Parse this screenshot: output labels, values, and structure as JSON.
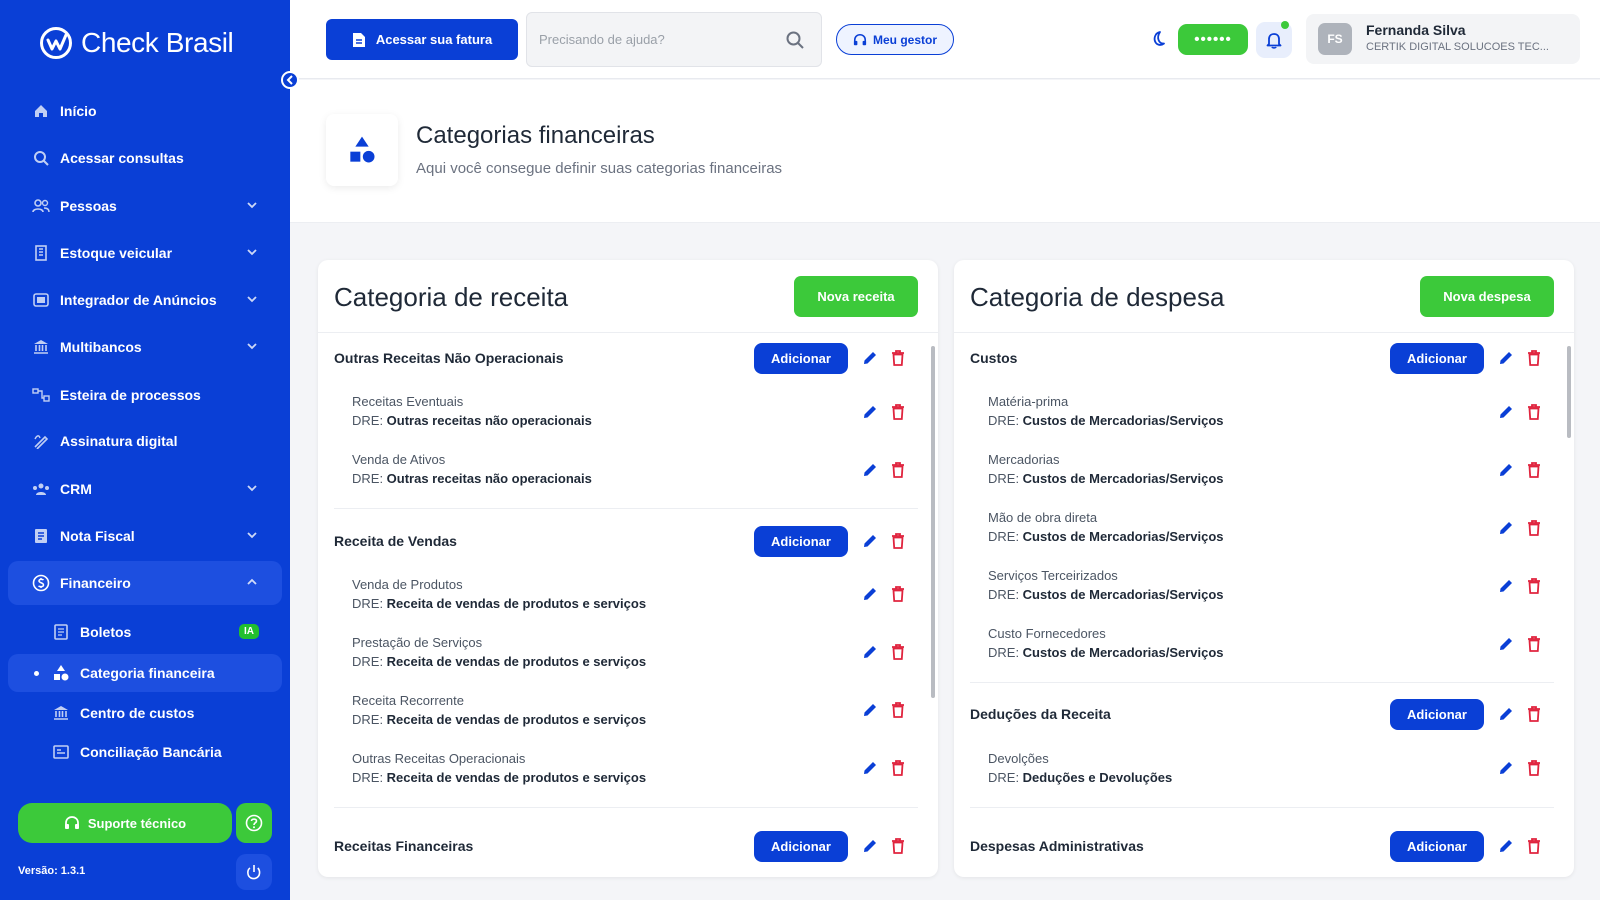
{
  "app": {
    "brand": "Check Brasil",
    "version": "Versão: 1.3.1"
  },
  "colors": {
    "primary": "#0a3fd6",
    "success": "#3cc93a",
    "danger": "#e0243e"
  },
  "sidebar": {
    "items": [
      {
        "label": "Início",
        "icon": "home-icon"
      },
      {
        "label": "Acessar consultas",
        "icon": "search-icon"
      },
      {
        "label": "Pessoas",
        "icon": "people-icon"
      },
      {
        "label": "Estoque veicular",
        "icon": "building-icon"
      },
      {
        "label": "Integrador de Anúncios",
        "icon": "integration-icon"
      },
      {
        "label": "Multibancos",
        "icon": "bank-icon"
      },
      {
        "label": "Esteira de processos",
        "icon": "workflow-icon"
      },
      {
        "label": "Assinatura digital",
        "icon": "signature-icon"
      },
      {
        "label": "CRM",
        "icon": "crm-icon"
      },
      {
        "label": "Nota Fiscal",
        "icon": "invoice-icon"
      },
      {
        "label": "Financeiro",
        "icon": "finance-icon"
      }
    ],
    "sub_items": [
      {
        "label": "Boletos",
        "badge": "IA",
        "icon": "document-icon"
      },
      {
        "label": "Categoria financeira",
        "icon": "shapes-icon"
      },
      {
        "label": "Centro de custos",
        "icon": "bank-icon"
      },
      {
        "label": "Conciliação Bancária",
        "icon": "reconciliation-icon"
      }
    ],
    "support_label": "Suporte técnico"
  },
  "topbar": {
    "invoice_label": "Acessar sua fatura",
    "search_placeholder": "Precisando de ajuda?",
    "manager_label": "Meu gestor",
    "masked_value": "••••••",
    "user": {
      "initials": "FS",
      "name": "Fernanda Silva",
      "company": "CERTIK DIGITAL SOLUCOES TEC..."
    }
  },
  "page": {
    "title": "Categorias financeiras",
    "subtitle": "Aqui você consegue definir suas categorias financeiras"
  },
  "labels": {
    "add": "Adicionar",
    "dre_prefix": "DRE: "
  },
  "income": {
    "title": "Categoria de receita",
    "new_label": "Nova receita",
    "groups": [
      {
        "title": "Outras Receitas Não Operacionais",
        "items": [
          {
            "name": "Receitas Eventuais",
            "dre": "Outras receitas não operacionais"
          },
          {
            "name": "Venda de Ativos",
            "dre": "Outras receitas não operacionais"
          }
        ]
      },
      {
        "title": "Receita de Vendas",
        "items": [
          {
            "name": "Venda de Produtos",
            "dre": "Receita de vendas de produtos e serviços"
          },
          {
            "name": "Prestação de Serviços",
            "dre": "Receita de vendas de produtos e serviços"
          },
          {
            "name": "Receita Recorrente",
            "dre": "Receita de vendas de produtos e serviços"
          },
          {
            "name": "Outras Receitas Operacionais",
            "dre": "Receita de vendas de produtos e serviços"
          }
        ]
      },
      {
        "title": "Receitas Financeiras",
        "items": []
      }
    ]
  },
  "expense": {
    "title": "Categoria de despesa",
    "new_label": "Nova despesa",
    "groups": [
      {
        "title": "Custos",
        "items": [
          {
            "name": "Matéria-prima",
            "dre": "Custos de Mercadorias/Serviços"
          },
          {
            "name": "Mercadorias",
            "dre": "Custos de Mercadorias/Serviços"
          },
          {
            "name": "Mão de obra direta",
            "dre": "Custos de Mercadorias/Serviços"
          },
          {
            "name": "Serviços Terceirizados",
            "dre": "Custos de Mercadorias/Serviços"
          },
          {
            "name": "Custo Fornecedores",
            "dre": "Custos de Mercadorias/Serviços"
          }
        ]
      },
      {
        "title": "Deduções da Receita",
        "items": [
          {
            "name": "Devolções",
            "dre": "Deduções e Devoluções"
          }
        ]
      },
      {
        "title": "Despesas Administrativas",
        "items": []
      }
    ]
  }
}
